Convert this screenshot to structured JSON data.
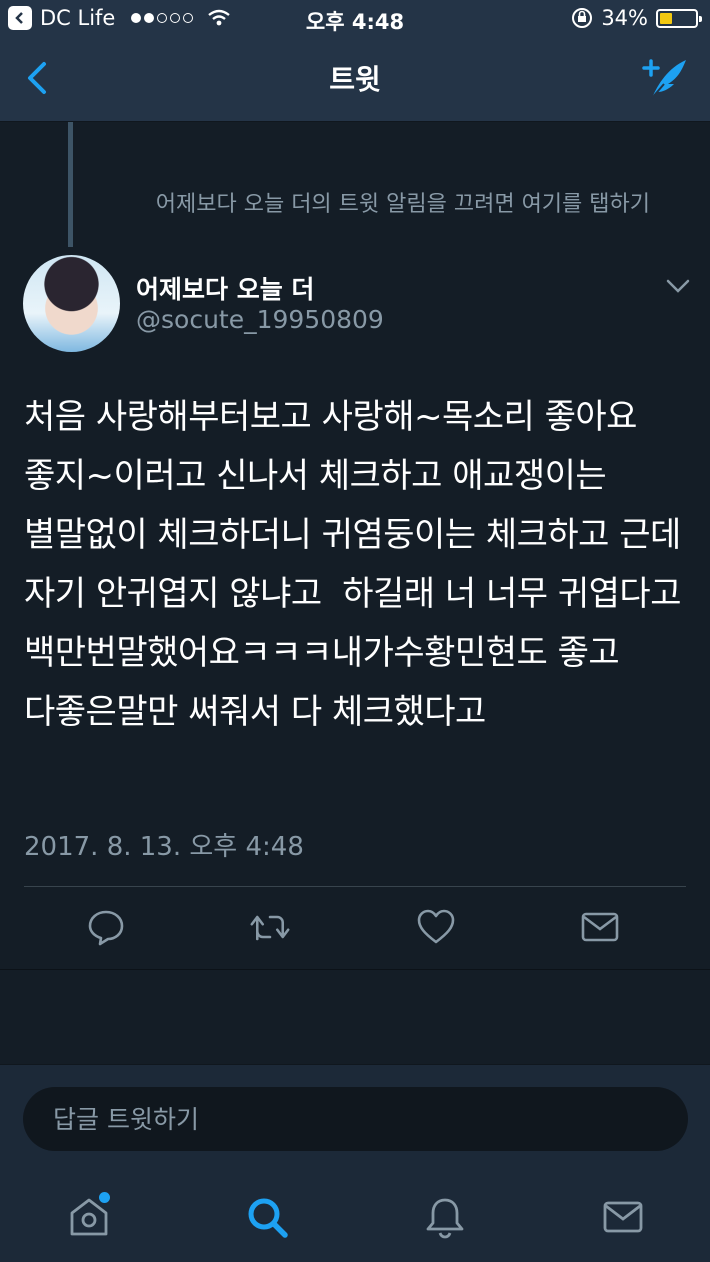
{
  "status_bar": {
    "app_name": "DC Life",
    "time": "오후 4:48",
    "battery": "34%",
    "battery_level": 0.34
  },
  "nav": {
    "title": "트윗"
  },
  "thread": {
    "notify_text": "어제보다 오늘 더의 트윗 알림을 끄려면 여기를 탭하기"
  },
  "tweet": {
    "user_name": "어제보다 오늘 더",
    "handle": "@socute_19950809",
    "text": "처음 사랑해부터보고 사랑해~목소리 좋아요 좋지~이러고 신나서 체크하고 애교쟁이는 별말없이 체크하더니 귀염둥이는 체크하고 근데 자기 안귀엽지 않냐고  하길래 너 너무 귀엽다고 백만번말했어요ㅋㅋㅋ내가수황민현도 좋고 다좋은말만 써줘서 다 체크했다고",
    "timestamp": "2017. 8. 13. 오후 4:48"
  },
  "reply": {
    "placeholder": "답글 트윗하기"
  },
  "icons": {
    "reply": "reply-icon",
    "retweet": "retweet-icon",
    "like": "heart-icon",
    "dm": "envelope-icon",
    "home": "home-icon",
    "search": "search-icon",
    "notifications": "bell-icon",
    "messages": "envelope-icon"
  },
  "colors": {
    "background": "#141d26",
    "header": "#243447",
    "accent": "#1da1f2",
    "secondary_text": "#8899a6"
  }
}
